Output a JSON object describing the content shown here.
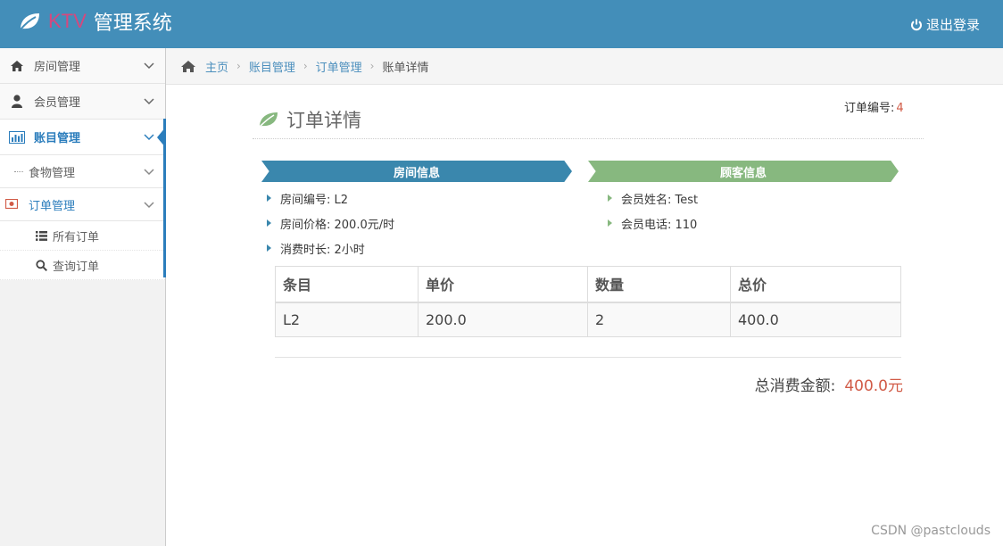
{
  "header": {
    "brand_prefix": "KTV",
    "brand_suffix": "管理系统",
    "logout_label": "退出登录",
    "bar_color": "#438eb9"
  },
  "sidebar": {
    "items": [
      {
        "label": "房间管理",
        "icon": "home-icon"
      },
      {
        "label": "会员管理",
        "icon": "user-icon"
      },
      {
        "label": "账目管理",
        "icon": "bar-chart-icon",
        "active": true
      }
    ],
    "sub_items": [
      {
        "label": "食物管理"
      },
      {
        "label": "订单管理",
        "icon": "money-icon",
        "open": true
      }
    ],
    "sub_sub_items": [
      {
        "label": "所有订单",
        "icon": "list-icon"
      },
      {
        "label": "查询订单",
        "icon": "search-icon"
      }
    ]
  },
  "breadcrumb": {
    "home": "主页",
    "level1": "账目管理",
    "level2": "订单管理",
    "current": "账单详情"
  },
  "order": {
    "number_label": "订单编号:",
    "number": "4",
    "page_title": "订单详情"
  },
  "room_info": {
    "title": "房间信息",
    "color": "#3a87ad",
    "lines": [
      "房间编号: L2",
      "房间价格: 200.0元/时",
      "消费时长: 2小时"
    ]
  },
  "guest_info": {
    "title": "顾客信息",
    "color": "#87b87f",
    "lines": [
      "会员姓名: Test",
      "会员电话: 110"
    ]
  },
  "table": {
    "headers": [
      "条目",
      "单价",
      "数量",
      "总价"
    ],
    "rows": [
      [
        "L2",
        "200.0",
        "2",
        "400.0"
      ]
    ]
  },
  "total": {
    "label": "总消费金额:",
    "amount": "400.0元",
    "amount_color": "#d15b47"
  },
  "watermark": "CSDN @pastclouds"
}
